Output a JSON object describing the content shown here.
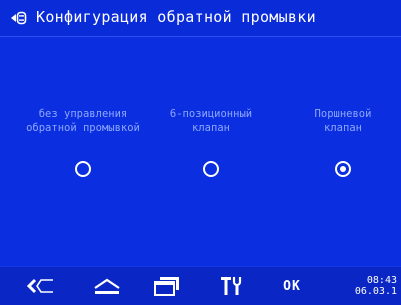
{
  "header": {
    "back_icon": "back-arrow-menu-icon",
    "title": "Конфигурация обратной промывки"
  },
  "options": [
    {
      "label": "без управления\nобратной промывкой",
      "selected": false
    },
    {
      "label": "6-позиционный\nклапан",
      "selected": false
    },
    {
      "label": "Поршневой\nклапан",
      "selected": true
    }
  ],
  "footer": {
    "buttons": [
      {
        "name": "back",
        "icon": "backspace-icon"
      },
      {
        "name": "home",
        "icon": "home-icon"
      },
      {
        "name": "windows",
        "icon": "windows-icon"
      },
      {
        "name": "tools",
        "icon": "tools-icon"
      }
    ],
    "ok_label": "OK",
    "time": "08:43",
    "date": "06.03.1"
  },
  "colors": {
    "background": "#0b2fe0",
    "header": "#0a2bd8",
    "footer": "#0a26c4",
    "label_text": "#8ea7ff",
    "text": "#ffffff"
  }
}
